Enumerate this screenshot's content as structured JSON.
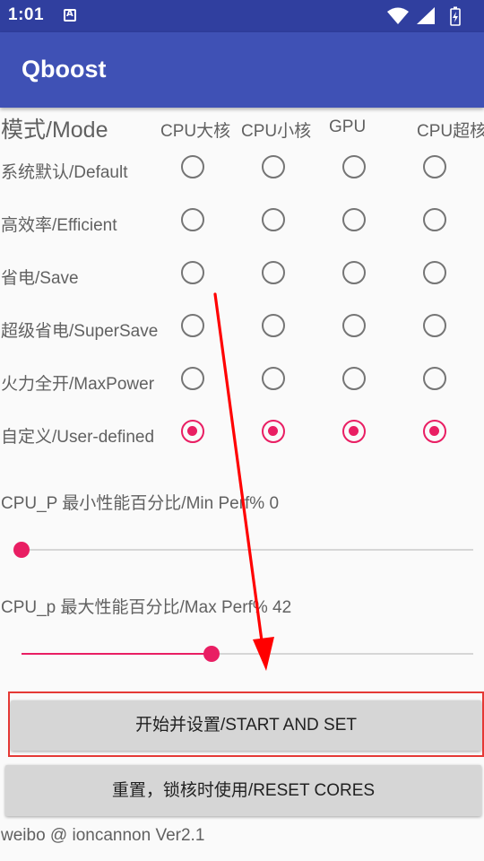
{
  "status_bar": {
    "time": "1:01",
    "icons": [
      "notification-icon",
      "wifi-icon",
      "signal-icon",
      "battery-icon"
    ]
  },
  "app_bar": {
    "title": "Qboost"
  },
  "mode_table": {
    "title": "模式/Mode",
    "columns": [
      "CPU大核",
      "CPU小核",
      "GPU",
      "CPU超核"
    ],
    "rows": [
      {
        "label": "系统默认/Default",
        "selected": [
          false,
          false,
          false,
          false
        ]
      },
      {
        "label": "高效率/Efficient",
        "selected": [
          false,
          false,
          false,
          false
        ]
      },
      {
        "label": "省电/Save",
        "selected": [
          false,
          false,
          false,
          false
        ]
      },
      {
        "label": "超级省电/SuperSave",
        "selected": [
          false,
          false,
          false,
          false
        ]
      },
      {
        "label": "火力全开/MaxPower",
        "selected": [
          false,
          false,
          false,
          false
        ]
      },
      {
        "label": "自定义/User-defined",
        "selected": [
          true,
          true,
          true,
          true
        ]
      }
    ]
  },
  "min_perf": {
    "label": "CPU_P 最小性能百分比/Min Perf% 0",
    "value": 0
  },
  "max_perf": {
    "label": "CPU_p 最大性能百分比/Max Perf% 42",
    "value": 42
  },
  "buttons": {
    "start": "开始并设置/START AND SET",
    "reset": "重置，锁核时使用/RESET CORES"
  },
  "footer": "weibo @ ioncannon Ver2.1",
  "colors": {
    "primary_dark": "#303f9f",
    "primary": "#3f51b5",
    "accent": "#e91e63",
    "annotation": "#ff0000"
  }
}
